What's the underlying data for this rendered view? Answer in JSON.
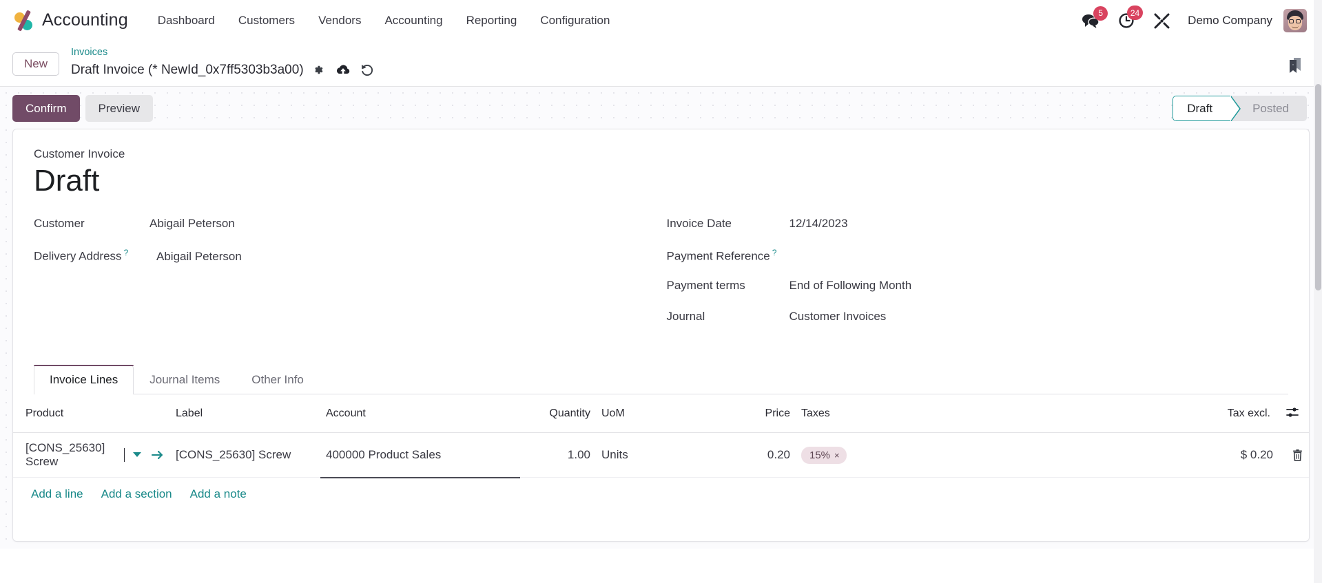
{
  "navbar": {
    "brand": "Accounting",
    "menu": [
      {
        "label": "Dashboard"
      },
      {
        "label": "Customers"
      },
      {
        "label": "Vendors"
      },
      {
        "label": "Accounting"
      },
      {
        "label": "Reporting"
      },
      {
        "label": "Configuration"
      }
    ],
    "messages_badge": "5",
    "activities_badge": "24",
    "company": "Demo Company",
    "icons": {
      "messages": "chat-bubbles-icon",
      "activities": "clock-icon",
      "debug": "tools-icon",
      "avatar": "user-avatar"
    }
  },
  "breadcrumb": {
    "new_label": "New",
    "parent": "Invoices",
    "current": "Draft Invoice (* NewId_0x7ff5303b3a00)",
    "actions": {
      "settings": "gear-icon",
      "save": "cloud-upload-icon",
      "discard": "undo-icon",
      "bookmark": "bookmark-icon"
    }
  },
  "actions": {
    "confirm_label": "Confirm",
    "preview_label": "Preview"
  },
  "statusbar": {
    "steps": [
      {
        "label": "Draft",
        "active": true
      },
      {
        "label": "Posted",
        "active": false
      }
    ]
  },
  "form": {
    "subtitle": "Customer Invoice",
    "title": "Draft",
    "left_fields": [
      {
        "label": "Customer",
        "value": "Abigail Peterson",
        "help": false
      },
      {
        "label": "Delivery Address",
        "value": "Abigail Peterson",
        "help": true
      }
    ],
    "right_fields": [
      {
        "label": "Invoice Date",
        "value": "12/14/2023",
        "help": false
      },
      {
        "label": "Payment Reference",
        "value": "",
        "help": true
      },
      {
        "label": "Payment terms",
        "value": "End of Following Month",
        "help": false
      },
      {
        "label": "Journal",
        "value": "Customer Invoices",
        "help": false
      }
    ]
  },
  "notebook": {
    "tabs": [
      {
        "label": "Invoice Lines",
        "active": true
      },
      {
        "label": "Journal Items",
        "active": false
      },
      {
        "label": "Other Info",
        "active": false
      }
    ]
  },
  "lines": {
    "headers": {
      "product": "Product",
      "label": "Label",
      "account": "Account",
      "quantity": "Quantity",
      "uom": "UoM",
      "price": "Price",
      "taxes": "Taxes",
      "subtotal": "Tax excl.",
      "options_icon": "sliders-icon"
    },
    "rows": [
      {
        "product": "[CONS_25630] Screw",
        "label": "[CONS_25630] Screw",
        "account": "400000 Product Sales",
        "quantity": "1.00",
        "uom": "Units",
        "price": "0.20",
        "tax_tag": "15%",
        "tax_tag_remove": "×",
        "subtotal": "$ 0.20",
        "delete_icon": "trash-icon"
      }
    ],
    "add_links": [
      {
        "label": "Add a line"
      },
      {
        "label": "Add a section"
      },
      {
        "label": "Add a note"
      }
    ]
  },
  "colors": {
    "brand_purple": "#714b67",
    "teal": "#1b8a8a",
    "badge_red": "#d9435f",
    "tag_bg": "#eedfe5"
  }
}
